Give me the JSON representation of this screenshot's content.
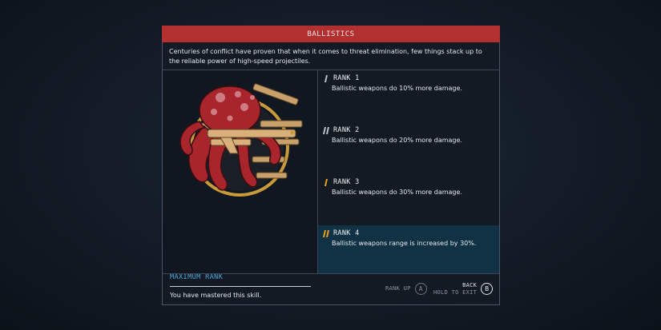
{
  "skill": {
    "title": "BALLISTICS",
    "description": "Centuries of conflict have proven that when it comes to threat elimination, few things stack up to the reliable power of high-speed projectiles.",
    "patch_icon": "octopus-with-rifles-patch"
  },
  "status": {
    "heading": "MAXIMUM RANK",
    "message": "You have mastered this skill."
  },
  "ranks": [
    {
      "label": "RANK 1",
      "description": "Ballistic weapons do 10% more damage.",
      "icon": "rank-1-icon",
      "active": false
    },
    {
      "label": "RANK 2",
      "description": "Ballistic weapons do 20% more damage.",
      "icon": "rank-2-icon",
      "active": false
    },
    {
      "label": "RANK 3",
      "description": "Ballistic weapons do 30% more damage.",
      "icon": "rank-3-icon",
      "active": false
    },
    {
      "label": "RANK 4",
      "description": "Ballistic weapons range is increased by 30%.",
      "icon": "rank-4-icon",
      "active": true
    }
  ],
  "controls": {
    "rank_up": {
      "label": "RANK UP",
      "button": "A"
    },
    "back": {
      "label": "BACK",
      "sublabel": "HOLD TO EXIT",
      "button": "B"
    }
  },
  "colors": {
    "title_bar": "#b23030",
    "accent_blue": "#4fa3d6",
    "rank_icon_gold": "#e6a21a",
    "active_row": "#113244"
  }
}
